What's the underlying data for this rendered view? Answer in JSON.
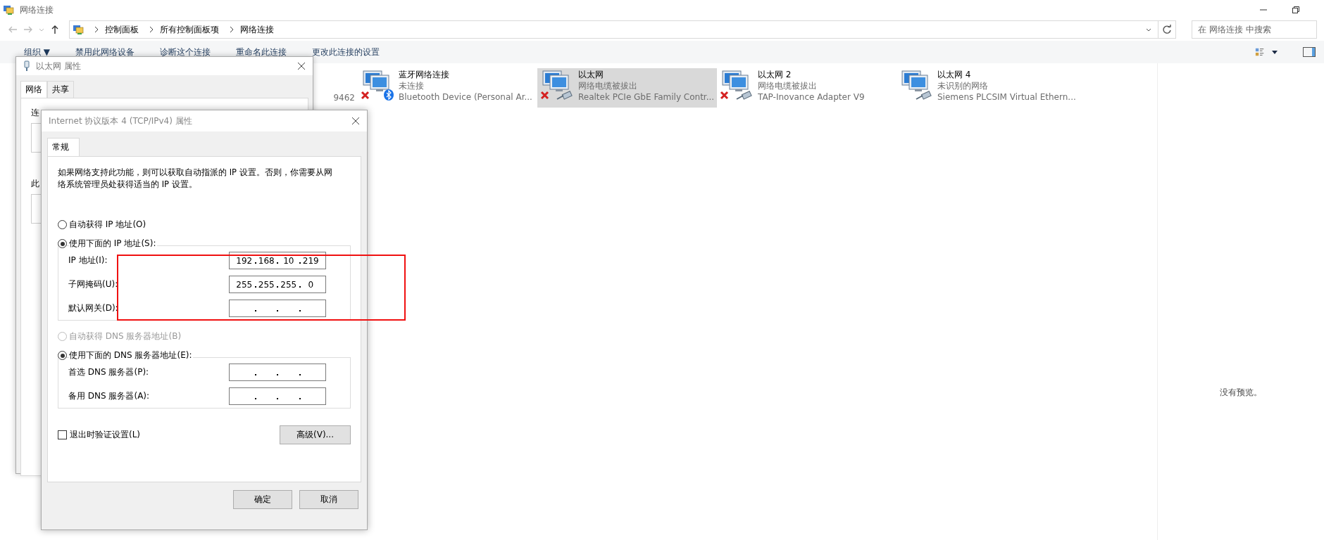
{
  "window": {
    "title": "网络连接"
  },
  "address": {
    "crumbs": [
      "控制面板",
      "所有控制面板项",
      "网络连接"
    ],
    "search_placeholder": "在 网络连接 中搜索"
  },
  "toolbar": [
    "组织 ▼",
    "禁用此网络设备",
    "诊断这个连接",
    "重命名此连接",
    "更改此连接的设置"
  ],
  "adapters": [
    {
      "kind": "partial",
      "device": "9462",
      "selected": false
    },
    {
      "kind": "bluetooth",
      "name": "蓝牙网络连接",
      "status": "未连接",
      "device": "Bluetooth Device (Personal Ar...",
      "disconnected": true,
      "selected": false
    },
    {
      "kind": "ethernet",
      "name": "以太网",
      "status": "网络电缆被拔出",
      "device": "Realtek PCIe GbE Family Contr...",
      "disconnected": true,
      "selected": true
    },
    {
      "kind": "ethernet",
      "name": "以太网 2",
      "status": "网络电缆被拔出",
      "device": "TAP-Inovance Adapter V9",
      "disconnected": true,
      "selected": false
    },
    {
      "kind": "ethernet",
      "name": "以太网 4",
      "status": "未识别的网络",
      "device": "Siemens PLCSIM Virtual Ethern...",
      "disconnected": false,
      "selected": false
    }
  ],
  "preview": {
    "text": "没有预览。"
  },
  "back_dialog": {
    "title": "以太网 属性",
    "tabs": [
      {
        "label": "网络",
        "selected": true
      },
      {
        "label": "共享",
        "selected": false
      }
    ],
    "labels": [
      "连",
      "此"
    ]
  },
  "dialog": {
    "title": "Internet 协议版本 4 (TCP/IPv4) 属性",
    "tab": "常规",
    "description": "如果网络支持此功能，则可以获取自动指派的 IP 设置。否则，你需要从网络系统管理员处获得适当的 IP 设置。",
    "ip_radios": [
      {
        "label": "自动获得 IP 地址(O)",
        "selected": false,
        "disabled": false
      },
      {
        "label": "使用下面的 IP 地址(S):",
        "selected": true,
        "disabled": false
      }
    ],
    "ip_fields": [
      {
        "label": "IP 地址(I):",
        "octets": [
          "192",
          "168",
          "10",
          "219"
        ]
      },
      {
        "label": "子网掩码(U):",
        "octets": [
          "255",
          "255",
          "255",
          "0"
        ]
      },
      {
        "label": "默认网关(D):"
      }
    ],
    "dns_radios": [
      {
        "label": "自动获得 DNS 服务器地址(B)",
        "selected": false,
        "disabled": true
      },
      {
        "label": "使用下面的 DNS 服务器地址(E):",
        "selected": true,
        "disabled": false
      }
    ],
    "dns_fields": [
      {
        "label": "首选 DNS 服务器(P):"
      },
      {
        "label": "备用 DNS 服务器(A):"
      }
    ],
    "validate": {
      "label": "退出时验证设置(L)",
      "checked": false
    },
    "advanced": "高级(V)...",
    "ok": "确定",
    "cancel": "取消"
  }
}
